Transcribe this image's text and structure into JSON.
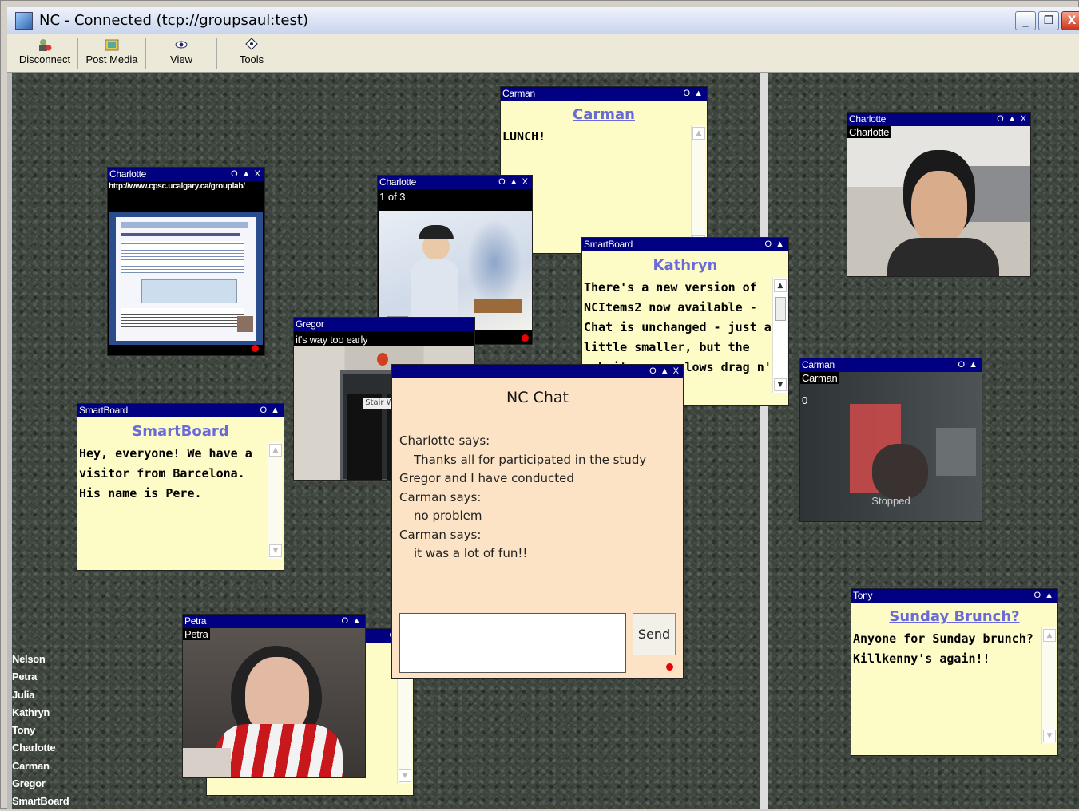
{
  "window": {
    "title": "NC - Connected (tcp://groupsaul:test)",
    "min_label": "_",
    "max_label": "❐",
    "close_label": "X"
  },
  "toolbar": {
    "disconnect": "Disconnect",
    "post_media": "Post Media",
    "view": "View",
    "tools": "Tools"
  },
  "card_controls": {
    "two": "O ▲",
    "three": "O ▲ X"
  },
  "web_item": {
    "owner": "Charlotte",
    "url": "http://www.cpsc.ucalgary.ca/grouplab/"
  },
  "slideshow": {
    "owner": "Charlotte",
    "counter": "1 of 3"
  },
  "note_carman": {
    "owner": "Carman",
    "title": "Carman",
    "body": "LUNCH!"
  },
  "note_kathryn": {
    "owner": "SmartBoard",
    "title": "Kathryn",
    "body": "There's a new version of NCItems2 now available - Chat is unchanged - just a little smaller, but the web item now alows drag n'"
  },
  "note_smartboard": {
    "owner": "SmartBoard",
    "title": "SmartBoard",
    "body": "Hey, everyone! We have a visitor from Barcelona. His name is Pere."
  },
  "video_gregor": {
    "owner": "Gregor",
    "caption": "it's way too early",
    "sign": "Stair Well"
  },
  "video_petra": {
    "owner": "Petra",
    "caption": "Petra"
  },
  "video_charlotte": {
    "owner": "Charlotte",
    "caption": "Charlotte"
  },
  "video_carman": {
    "owner": "Carman",
    "caption": "Carman",
    "counter": "0",
    "status": "Stopped"
  },
  "note_tony": {
    "owner": "Tony",
    "title": "Sunday Brunch?",
    "body": "Anyone for Sunday brunch? Killkenny's again!!"
  },
  "chat": {
    "title": "NC Chat",
    "send_label": "Send",
    "lines": [
      {
        "text": "Charlotte says:",
        "indent": false
      },
      {
        "text": "Thanks all for participated in the study",
        "indent": true
      },
      {
        "text": "Gregor and I have conducted",
        "indent": false
      },
      {
        "text": "Carman says:",
        "indent": false
      },
      {
        "text": "no problem",
        "indent": true
      },
      {
        "text": "Carman says:",
        "indent": false
      },
      {
        "text": "it was a lot of fun!!",
        "indent": true
      }
    ]
  },
  "users": [
    "Nelson",
    "Petra",
    "Julia",
    "Kathryn",
    "Tony",
    "Charlotte",
    "Carman",
    "Gregor",
    "SmartBoard"
  ],
  "colors": {
    "header": "#000080",
    "note_bg": "#fdfbc6",
    "chat_bg": "#fde3c5",
    "link": "#6a6ad8",
    "status_dot": "#ee0000"
  }
}
